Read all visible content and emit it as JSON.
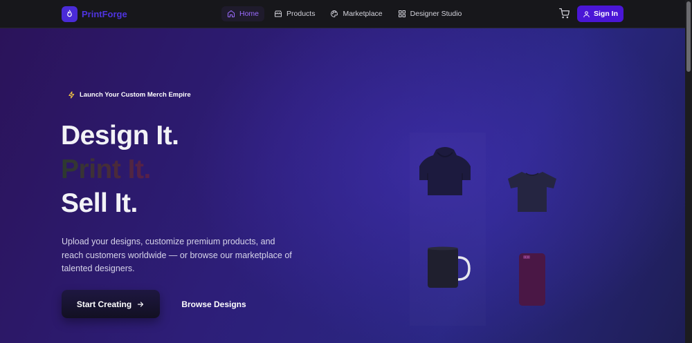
{
  "nav": {
    "brand": "PrintForge",
    "links": [
      {
        "label": "Home",
        "icon": "home-icon",
        "active": true
      },
      {
        "label": "Products",
        "icon": "store-icon",
        "active": false
      },
      {
        "label": "Marketplace",
        "icon": "palette-icon",
        "active": false
      },
      {
        "label": "Designer Studio",
        "icon": "grid-icon",
        "active": false
      }
    ],
    "signin": "Sign In"
  },
  "hero": {
    "badge": "Launch Your Custom Merch Empire",
    "heading": [
      "Design It.",
      "Print It.",
      "Sell It."
    ],
    "description": "Upload your designs, customize premium products, and reach customers worldwide — or browse our marketplace of talented designers.",
    "primary_cta": "Start Creating",
    "secondary_cta": "Browse Designs"
  },
  "colors": {
    "accent": "#4a16d6",
    "brand_text": "#4f34e0",
    "active_link": "#9b6cff"
  }
}
